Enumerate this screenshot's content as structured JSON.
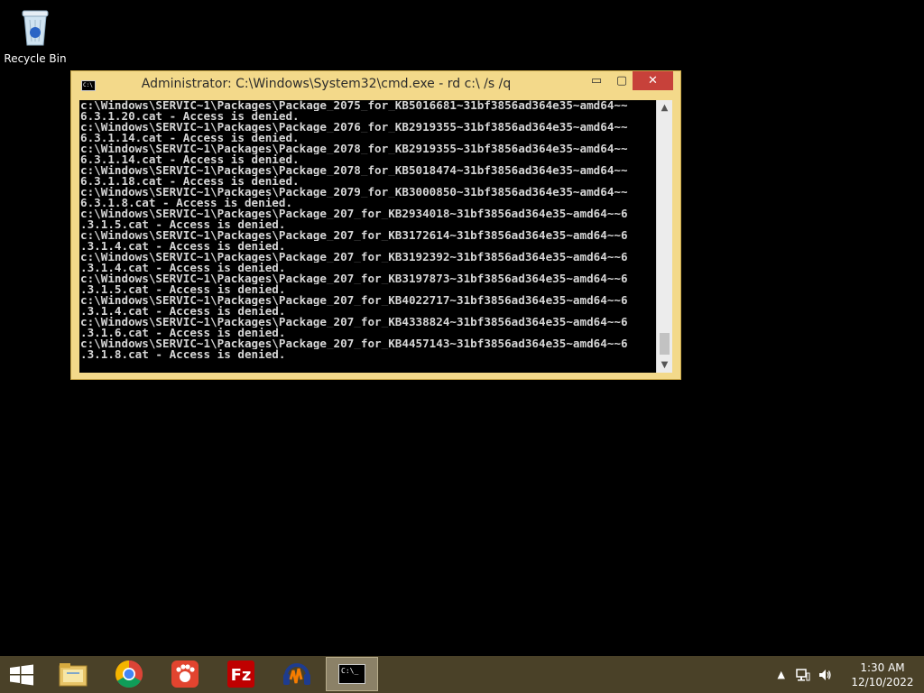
{
  "desktop": {
    "recycle_bin_label": "Recycle Bin"
  },
  "window": {
    "title": "Administrator: C:\\Windows\\System32\\cmd.exe - rd  c:\\ /s /q",
    "minimize_glyph": "▭",
    "maximize_glyph": "▢",
    "close_glyph": "✕",
    "app_icon_text": "C:\\",
    "lines": [
      "c:\\Windows\\SERVIC~1\\Packages\\Package_2075_for_KB5016681~31bf3856ad364e35~amd64~~",
      "6.3.1.20.cat - Access is denied.",
      "c:\\Windows\\SERVIC~1\\Packages\\Package_2076_for_KB2919355~31bf3856ad364e35~amd64~~",
      "6.3.1.14.cat - Access is denied.",
      "c:\\Windows\\SERVIC~1\\Packages\\Package_2078_for_KB2919355~31bf3856ad364e35~amd64~~",
      "6.3.1.14.cat - Access is denied.",
      "c:\\Windows\\SERVIC~1\\Packages\\Package_2078_for_KB5018474~31bf3856ad364e35~amd64~~",
      "6.3.1.18.cat - Access is denied.",
      "c:\\Windows\\SERVIC~1\\Packages\\Package_2079_for_KB3000850~31bf3856ad364e35~amd64~~",
      "6.3.1.8.cat - Access is denied.",
      "c:\\Windows\\SERVIC~1\\Packages\\Package_207_for_KB2934018~31bf3856ad364e35~amd64~~6",
      ".3.1.5.cat - Access is denied.",
      "c:\\Windows\\SERVIC~1\\Packages\\Package_207_for_KB3172614~31bf3856ad364e35~amd64~~6",
      ".3.1.4.cat - Access is denied.",
      "c:\\Windows\\SERVIC~1\\Packages\\Package_207_for_KB3192392~31bf3856ad364e35~amd64~~6",
      ".3.1.4.cat - Access is denied.",
      "c:\\Windows\\SERVIC~1\\Packages\\Package_207_for_KB3197873~31bf3856ad364e35~amd64~~6",
      ".3.1.5.cat - Access is denied.",
      "c:\\Windows\\SERVIC~1\\Packages\\Package_207_for_KB4022717~31bf3856ad364e35~amd64~~6",
      ".3.1.4.cat - Access is denied.",
      "c:\\Windows\\SERVIC~1\\Packages\\Package_207_for_KB4338824~31bf3856ad364e35~amd64~~6",
      ".3.1.6.cat - Access is denied.",
      "c:\\Windows\\SERVIC~1\\Packages\\Package_207_for_KB4457143~31bf3856ad364e35~amd64~~6",
      ".3.1.8.cat - Access is denied."
    ]
  },
  "taskbar": {
    "apps": [
      {
        "name": "file-explorer-icon"
      },
      {
        "name": "chrome-icon"
      },
      {
        "name": "paw-app-icon"
      },
      {
        "name": "filezilla-icon"
      },
      {
        "name": "audacity-icon"
      },
      {
        "name": "cmd-icon",
        "active": true
      }
    ],
    "cmd_icon_text": "C:\\_",
    "filezilla_text": "Fz",
    "tray_arrow": "▲",
    "clock_time": "1:30 AM",
    "clock_date": "12/10/2022"
  },
  "colors": {
    "window_frame": "#f3d98a",
    "close_button": "#c7413a",
    "taskbar": "#4a4128",
    "console_text": "#d6d6d6"
  }
}
